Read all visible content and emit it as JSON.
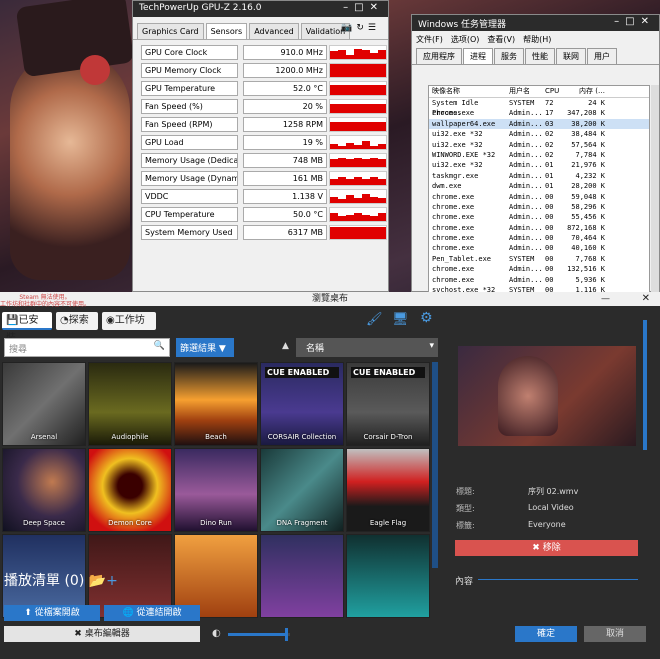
{
  "gpuz": {
    "title": "TechPowerUp GPU-Z 2.16.0",
    "tabs": [
      "Graphics Card",
      "Sensors",
      "Advanced",
      "Validation"
    ],
    "active_tab": "Sensors",
    "icons": [
      "camera-icon",
      "refresh-icon",
      "menu-icon"
    ],
    "sensors": [
      {
        "label": "GPU Core Clock",
        "value": "910.0 MHz",
        "graph": [
          0.6,
          0.7,
          0.3,
          0.8,
          0.7,
          0.5,
          0.7
        ]
      },
      {
        "label": "GPU Memory Clock",
        "value": "1200.0 MHz",
        "graph": [
          1,
          1,
          1,
          1,
          1,
          1,
          1
        ]
      },
      {
        "label": "GPU Temperature",
        "value": "52.0 °C",
        "graph": [
          0.75,
          0.75,
          0.75,
          0.75,
          0.75,
          0.75,
          0.75
        ]
      },
      {
        "label": "Fan Speed (%)",
        "value": "20 %",
        "graph": [
          0.7,
          0.7,
          0.7,
          0.7,
          0.7,
          0.7,
          0.7
        ]
      },
      {
        "label": "Fan Speed (RPM)",
        "value": "1258 RPM",
        "graph": [
          0.7,
          0.7,
          0.7,
          0.7,
          0.7,
          0.7,
          0.7
        ]
      },
      {
        "label": "GPU Load",
        "value": "19 %",
        "graph": [
          0.4,
          0.2,
          0.5,
          0.3,
          0.6,
          0.2,
          0.4
        ]
      },
      {
        "label": "Memory Usage (Dedicated)",
        "value": "748 MB",
        "graph": [
          0.6,
          0.7,
          0.6,
          0.7,
          0.6,
          0.7,
          0.6
        ]
      },
      {
        "label": "Memory Usage (Dynamic)",
        "value": "161 MB",
        "graph": [
          0.5,
          0.6,
          0.5,
          0.6,
          0.5,
          0.6,
          0.5
        ]
      },
      {
        "label": "VDDC",
        "value": "1.138 V",
        "graph": [
          0.5,
          0.3,
          0.6,
          0.4,
          0.7,
          0.5,
          0.4
        ]
      },
      {
        "label": "CPU Temperature",
        "value": "50.0 °C",
        "graph": [
          0.6,
          0.4,
          0.5,
          0.6,
          0.5,
          0.4,
          0.6
        ]
      },
      {
        "label": "System Memory Used",
        "value": "6317 MB",
        "graph": [
          0.9,
          0.9,
          0.9,
          0.9,
          0.9,
          0.9,
          0.9
        ]
      }
    ]
  },
  "taskmgr": {
    "title": "Windows 任务管理器",
    "menu": [
      "文件(F)",
      "选项(O)",
      "查看(V)",
      "帮助(H)"
    ],
    "tabs": [
      "应用程序",
      "进程",
      "服务",
      "性能",
      "联网",
      "用户"
    ],
    "active_tab": "进程",
    "columns": [
      "映像名称",
      "用户名",
      "CPU",
      "内存 (…"
    ],
    "rows": [
      [
        "System Idle Process",
        "SYSTEM",
        "72",
        "24 K"
      ],
      [
        "chrome.exe",
        "Admin...",
        "17",
        "347,208 K"
      ],
      [
        "wallpaper64.exe",
        "Admin...",
        "03",
        "38,200 K"
      ],
      [
        "ui32.exe *32",
        "Admin...",
        "02",
        "38,484 K"
      ],
      [
        "ui32.exe *32",
        "Admin...",
        "02",
        "57,564 K"
      ],
      [
        "WINWORD.EXE *32",
        "Admin...",
        "02",
        "7,784 K"
      ],
      [
        "ui32.exe *32",
        "Admin...",
        "01",
        "21,976 K"
      ],
      [
        "taskmgr.exe",
        "Admin...",
        "01",
        "4,232 K"
      ],
      [
        "dwm.exe",
        "Admin...",
        "01",
        "28,200 K"
      ],
      [
        "chrome.exe",
        "Admin...",
        "00",
        "59,048 K"
      ],
      [
        "chrome.exe",
        "Admin...",
        "00",
        "58,296 K"
      ],
      [
        "chrome.exe",
        "Admin...",
        "00",
        "55,456 K"
      ],
      [
        "chrome.exe",
        "Admin...",
        "00",
        "872,168 K"
      ],
      [
        "chrome.exe",
        "Admin...",
        "00",
        "70,464 K"
      ],
      [
        "chrome.exe",
        "Admin...",
        "00",
        "40,160 K"
      ],
      [
        "Pen_Tablet.exe",
        "SYSTEM",
        "00",
        "7,768 K"
      ],
      [
        "chrome.exe",
        "Admin...",
        "00",
        "132,516 K"
      ],
      [
        "chrome.exe",
        "Admin...",
        "00",
        "5,936 K"
      ],
      [
        "svchost.exe *32",
        "SYSTEM",
        "00",
        "1,116 K"
      ]
    ]
  },
  "we": {
    "title": "瀏覽桌布",
    "warn1": "Steam 無法使用。",
    "warn2": "工作坊和社群中的內容不可使用。",
    "tabs": [
      "已安裝",
      "探索",
      "工作坊"
    ],
    "icons": [
      "brush-icon",
      "monitor-icon",
      "gear-icon"
    ],
    "search_placeholder": "搜尋",
    "filter_label": "篩選結果",
    "sort_label": "名稱",
    "wallpapers": [
      {
        "name": "Arsenal",
        "bg": "linear-gradient(135deg,#3a3a3a,#707070 50%,#202020)"
      },
      {
        "name": "Audiophile",
        "bg": "linear-gradient(180deg,#2a2a10,#6a6a20 60%,#1a1a08)"
      },
      {
        "name": "Beach",
        "bg": "linear-gradient(180deg,#1a1a1a,#f6a030 45%,#a04010 70%,#201010)"
      },
      {
        "name": "CORSAIR Collection",
        "bg": "linear-gradient(180deg,#2a2a60,#4a3a90 60%,#1a1a40)",
        "cue": "CUE ENABLED"
      },
      {
        "name": "Corsair D-Tron",
        "bg": "linear-gradient(180deg,#3a3a3a,#5a5a5a 60%,#202020)",
        "cue": "CUE ENABLED"
      },
      {
        "name": "Deep Space",
        "bg": "radial-gradient(circle at 60% 40%,#c07a50,#3a2a4a 50%,#101020)"
      },
      {
        "name": "Demon Core",
        "bg": "radial-gradient(circle at 50% 45%,#3a0000 20%,#f0c020 45%,#d01010 80%)"
      },
      {
        "name": "Dino Run",
        "bg": "linear-gradient(180deg,#3a2a60,#9a5a9a 55%,#201030)"
      },
      {
        "name": "DNA Fragment",
        "bg": "linear-gradient(135deg,#1a3a3a,#4a8a8a 50%,#102020)"
      },
      {
        "name": "Eagle Flag",
        "bg": "linear-gradient(180deg,#c0c0c0,#d02020 40%,#1a1a1a 70%)"
      },
      {
        "name": "",
        "bg": "linear-gradient(180deg,#203060,#4a6aa0)"
      },
      {
        "name": "",
        "bg": "linear-gradient(180deg,#401818,#803030)"
      },
      {
        "name": "",
        "bg": "linear-gradient(180deg,#f0a040,#a04010)"
      },
      {
        "name": "",
        "bg": "linear-gradient(180deg,#303060,#8040a0)"
      },
      {
        "name": "",
        "bg": "linear-gradient(180deg,#103030,#20a0a0)"
      }
    ],
    "details": {
      "title_k": "標題:",
      "title_v": "序列 02.wmv",
      "type_k": "類型:",
      "type_v": "Local Video",
      "rating_k": "標籤:",
      "rating_v": "Everyone"
    },
    "remove_label": "✖ 移除",
    "content_label": "內容",
    "playlist_label": "播放清單 (0)",
    "open_file": "從檔案開啟",
    "open_url": "從連結開啟",
    "editor": "桌布編輯器",
    "volume_level": 0.95,
    "ok": "確定",
    "cancel": "取消",
    "accent": "#2a77c9"
  }
}
